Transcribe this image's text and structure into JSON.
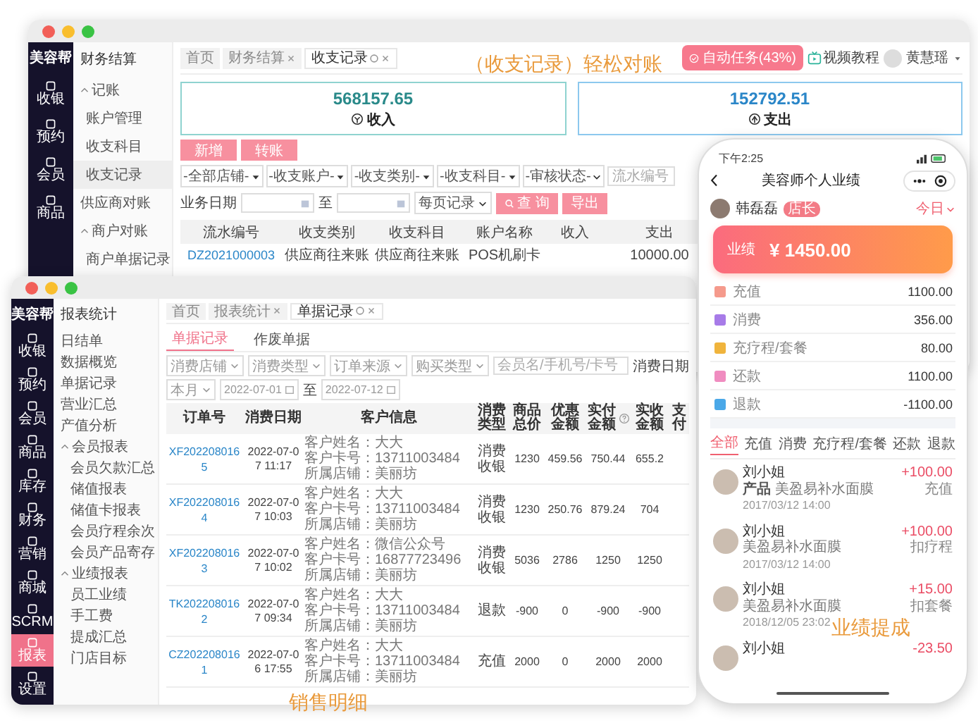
{
  "back_window": {
    "logo": "美容帮",
    "nav": [
      {
        "label": "收银",
        "selected": false
      },
      {
        "label": "预约",
        "selected": false
      },
      {
        "label": "会员",
        "selected": false
      },
      {
        "label": "商品",
        "selected": false
      }
    ],
    "menu_title": "财务结算",
    "menu": [
      {
        "kind": "group",
        "label": "记账",
        "expanded": true,
        "selected": false,
        "children": [
          {
            "label": "账户管理",
            "selected": false
          },
          {
            "label": "收支科目",
            "selected": false
          },
          {
            "label": "收支记录",
            "selected": true
          }
        ]
      },
      {
        "kind": "item",
        "label": "供应商对账",
        "selected": false
      },
      {
        "kind": "group",
        "label": "商户对账",
        "expanded": true,
        "selected": false,
        "children": [
          {
            "label": "商户单据记录",
            "selected": false
          }
        ]
      }
    ],
    "tabs": [
      {
        "label": "首页",
        "closable": false,
        "refreshable": false,
        "selected": false
      },
      {
        "label": "财务结算",
        "closable": true,
        "refreshable": false,
        "selected": false
      },
      {
        "label": "收支记录",
        "closable": true,
        "refreshable": true,
        "selected": true
      }
    ],
    "task_button": "自动任务(43%)",
    "video_link": "视频教程",
    "user_name": "黄慧瑶",
    "summary": [
      {
        "kind": "income",
        "amount": "568157.65",
        "label": "收入"
      },
      {
        "kind": "expense",
        "amount": "152792.51",
        "label": "支出"
      }
    ],
    "actions": [
      "新增",
      "转账"
    ],
    "filters": [
      {
        "kind": "select",
        "label": "-全部店铺-"
      },
      {
        "kind": "select",
        "label": "-收支账户-"
      },
      {
        "kind": "select",
        "label": "-收支类别-"
      },
      {
        "kind": "select",
        "label": "-收支科目-"
      },
      {
        "kind": "chevron",
        "label": "-审核状态-"
      },
      {
        "kind": "input",
        "placeholder": "流水编号"
      }
    ],
    "date_label": "业务日期",
    "date_separator": "至",
    "page_size": "每页记录",
    "search_button": "查 询",
    "export_button": "导出",
    "table": {
      "columns": [
        "流水编号",
        "收支类别",
        "收支科目",
        "账户名称",
        "收入",
        "支出"
      ],
      "rows": [
        {
          "serial": "DZ2021000003",
          "category": "供应商往来账",
          "subject": "供应商往来账",
          "account": "POS机刷卡",
          "expense": "10000.00"
        }
      ]
    }
  },
  "front_window": {
    "logo": "美容帮",
    "nav": [
      {
        "label": "收银",
        "selected": false
      },
      {
        "label": "预约",
        "selected": false
      },
      {
        "label": "会员",
        "selected": false
      },
      {
        "label": "商品",
        "selected": false
      },
      {
        "label": "库存",
        "selected": false
      },
      {
        "label": "财务",
        "selected": false
      },
      {
        "label": "营销",
        "selected": false
      },
      {
        "label": "商城",
        "selected": false
      },
      {
        "label": "SCRM",
        "selected": false
      },
      {
        "label": "报表",
        "selected": true
      },
      {
        "label": "设置",
        "selected": false
      }
    ],
    "menu_title": "报表统计",
    "menu": [
      {
        "kind": "item",
        "label": "日结单",
        "selected": false
      },
      {
        "kind": "item",
        "label": "数据概览",
        "selected": false
      },
      {
        "kind": "item",
        "label": "单据记录",
        "selected": false
      },
      {
        "kind": "item",
        "label": "营业汇总",
        "selected": false
      },
      {
        "kind": "item",
        "label": "产值分析",
        "selected": false
      },
      {
        "kind": "group",
        "label": "会员报表",
        "expanded": true,
        "selected": false,
        "children": [
          {
            "label": "会员欠款汇总",
            "selected": false
          },
          {
            "label": "储值报表",
            "selected": false
          },
          {
            "label": "储值卡报表",
            "selected": false
          },
          {
            "label": "会员疗程余次",
            "selected": false
          },
          {
            "label": "会员产品寄存",
            "selected": false
          }
        ]
      },
      {
        "kind": "group",
        "label": "业绩报表",
        "expanded": true,
        "selected": false,
        "children": [
          {
            "label": "员工业绩",
            "selected": false
          },
          {
            "label": "手工费",
            "selected": false
          },
          {
            "label": "提成汇总",
            "selected": false
          },
          {
            "label": "门店目标",
            "selected": false
          }
        ]
      }
    ],
    "tabs": [
      {
        "label": "首页",
        "closable": false,
        "refreshable": false,
        "selected": false
      },
      {
        "label": "报表统计",
        "closable": true,
        "refreshable": false,
        "selected": false
      },
      {
        "label": "单据记录",
        "closable": true,
        "refreshable": true,
        "selected": true
      }
    ],
    "subtabs": [
      {
        "label": "单据记录",
        "selected": true
      },
      {
        "label": "作废单据",
        "selected": false
      }
    ],
    "filters": [
      {
        "kind": "select",
        "label": "消费店铺"
      },
      {
        "kind": "select",
        "label": "消费类型"
      },
      {
        "kind": "select",
        "label": "订单来源"
      },
      {
        "kind": "select",
        "label": "购买类型"
      },
      {
        "kind": "input",
        "placeholder": "会员名/手机号/卡号"
      },
      {
        "kind": "label",
        "label": "消费日期"
      },
      {
        "kind": "select",
        "label": "本月"
      },
      {
        "kind": "date",
        "label": "2022-07-01"
      },
      {
        "kind": "label",
        "label": "至"
      },
      {
        "kind": "date",
        "label": "2022-07-12"
      }
    ],
    "table": {
      "columns": [
        {
          "label": "订单号",
          "help": false
        },
        {
          "label": "消费日期",
          "help": false
        },
        {
          "label": "客户信息",
          "help": false
        },
        {
          "label": "消费类型",
          "help": false
        },
        {
          "label": "商品总价",
          "help": false
        },
        {
          "label": "优惠金额",
          "help": false
        },
        {
          "label": "实付金额",
          "help": true
        },
        {
          "label": "实收金额",
          "help": false
        },
        {
          "label": "支付",
          "help": false
        }
      ],
      "rows": [
        {
          "order": "XF2022080165",
          "date": "2022-07-07 11:17",
          "customer": [
            "客户姓名：大大",
            "客户卡号：13711003484",
            "所属店铺：美丽坊"
          ],
          "type": "消费收银",
          "total": "1230",
          "discount": "459.56",
          "paid": "750.44",
          "received": "655.2"
        },
        {
          "order": "XF2022080164",
          "date": "2022-07-07 10:03",
          "customer": [
            "客户姓名：大大",
            "客户卡号：13711003484",
            "所属店铺：美丽坊"
          ],
          "type": "消费收银",
          "total": "1230",
          "discount": "250.76",
          "paid": "879.24",
          "received": "704"
        },
        {
          "order": "XF2022080163",
          "date": "2022-07-07 10:02",
          "customer": [
            "客户姓名：微信公众号",
            "客户卡号：16877723496",
            "所属店铺：美丽坊"
          ],
          "type": "消费收银",
          "total": "5036",
          "discount": "2786",
          "paid": "1250",
          "received": "1250"
        },
        {
          "order": "TK2022080162",
          "date": "2022-07-07 09:34",
          "customer": [
            "客户姓名：大大",
            "客户卡号：13711003484",
            "所属店铺：美丽坊"
          ],
          "type": "退款",
          "total": "-900",
          "discount": "0",
          "paid": "-900",
          "received": "-900"
        },
        {
          "order": "CZ2022080161",
          "date": "2022-07-06 17:55",
          "customer": [
            "客户姓名：大大",
            "客户卡号：13711003484",
            "所属店铺：美丽坊"
          ],
          "type": "充值",
          "total": "2000",
          "discount": "0",
          "paid": "2000",
          "received": "2000"
        }
      ]
    }
  },
  "phone": {
    "time": "下午2:25",
    "title": "美容师个人业绩",
    "user_name": "韩磊磊",
    "badge": "店长",
    "period": "今日",
    "card_label": "业绩",
    "card_amount": "¥ 1450.00",
    "stats": [
      {
        "kind": "recharge",
        "label": "充值",
        "value": "1100.00"
      },
      {
        "kind": "consume",
        "label": "消费",
        "value": "356.00"
      },
      {
        "kind": "package",
        "label": "充疗程/套餐",
        "value": "80.00"
      },
      {
        "kind": "repay",
        "label": "还款",
        "value": "1100.00"
      },
      {
        "kind": "refund",
        "label": "退款",
        "value": "-1100.00"
      }
    ],
    "tabs": [
      {
        "label": "全部",
        "selected": true
      },
      {
        "label": "充值",
        "selected": false
      },
      {
        "label": "消费",
        "selected": false
      },
      {
        "label": "充疗程/套餐",
        "selected": false
      },
      {
        "label": "还款",
        "selected": false
      },
      {
        "label": "退款",
        "selected": false
      }
    ],
    "records": [
      {
        "name": "刘小姐",
        "tag": "产品",
        "item": "美盈易补水面膜",
        "time": "2017/03/12  14:00",
        "amount": "+100.00",
        "type": "充值"
      },
      {
        "name": "刘小姐",
        "item": "美盈易补水面膜",
        "time": "2017/03/12  14:00",
        "amount": "+100.00",
        "type": "扣疗程"
      },
      {
        "name": "刘小姐",
        "item": "美盈易补水面膜",
        "time": "2018/12/05  23:02",
        "amount": "+15.00",
        "type": "扣套餐"
      },
      {
        "name": "刘小姐",
        "amount": "-23.50"
      }
    ]
  },
  "captions": {
    "top": "（收支记录）轻松对账",
    "bottom": "销售明细",
    "phone": "业绩提成"
  }
}
